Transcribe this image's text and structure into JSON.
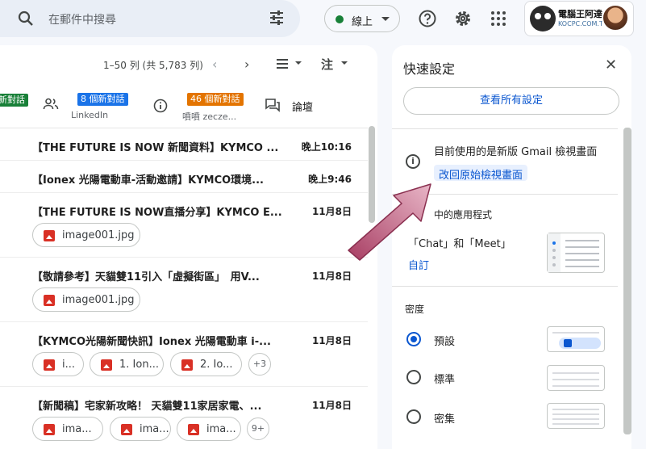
{
  "search": {
    "placeholder": "在郵件中搜尋"
  },
  "status": {
    "label": "線上",
    "dot_color": "#188038"
  },
  "brand": {
    "title": "電腦王阿達",
    "subtitle": "KOCPC.COM.TW"
  },
  "toolbar": {
    "pager": "1–50 列 (共 5,783 列)",
    "note": "注"
  },
  "tabs": [
    {
      "badge": "新對話",
      "badge_color": "#188038",
      "sub": ""
    },
    {
      "badge": "8 個新對話",
      "badge_color": "#1a73e8",
      "sub": "LinkedIn",
      "icon": "people-icon"
    },
    {
      "badge": "46 個新對話",
      "badge_color": "#e37400",
      "sub": "噴噴 zecze...",
      "icon": "info-icon"
    },
    {
      "label": "論壇",
      "icon": "forum-icon"
    }
  ],
  "emails": [
    {
      "subject": "【THE FUTURE IS NOW 新聞資料】KYMCO ...",
      "time": "晚上10:16"
    },
    {
      "subject": "【Ionex 光陽電動車-活動邀請】KYMCO環境...",
      "time": "晚上9:46"
    },
    {
      "subject": "【THE FUTURE IS NOW直播分享】KYMCO E...",
      "time": "11月8日",
      "attachments": [
        "image001.jpg"
      ]
    },
    {
      "subject": "【敬請參考】天貓雙11引入「虛擬街區」　用V...",
      "time": "11月8日",
      "attachments": [
        "image001.jpg"
      ]
    },
    {
      "subject": "【KYMCO光陽新聞快訊】Ionex 光陽電動車 i-...",
      "time": "11月8日",
      "attachments": [
        "i...",
        "1. Ion...",
        "2. Io..."
      ],
      "more": "+3"
    },
    {
      "subject": "【新聞稿】宅家新攻略！ 天貓雙11家居家電、...",
      "time": "11月8日",
      "attachments": [
        "ima...",
        "ima...",
        "ima..."
      ],
      "more": "9+"
    }
  ],
  "quick_settings": {
    "title": "快速設定",
    "see_all": "查看所有設定",
    "version_text": "目前使用的是新版 Gmail 檢視畫面",
    "revert_link": "改回原始檢視畫面",
    "apps_heading": "中的應用程式",
    "chat_meet": "「Chat」和「Meet」",
    "customize": "自訂",
    "density_heading": "密度",
    "density_options": [
      {
        "label": "預設",
        "selected": true
      },
      {
        "label": "標準",
        "selected": false
      },
      {
        "label": "密集",
        "selected": false
      }
    ]
  },
  "colors": {
    "accent": "#0b57d0",
    "annotation_arrow": "#c2577a"
  }
}
